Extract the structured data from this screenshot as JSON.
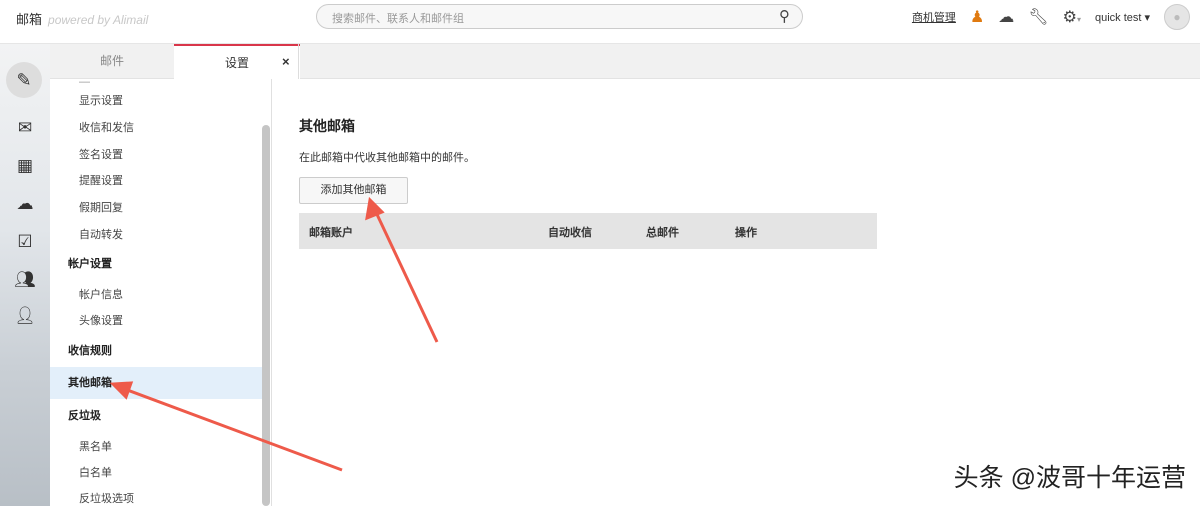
{
  "header": {
    "app": "邮箱",
    "powered": "powered by Alimail",
    "search_placeholder": "搜索邮件、联系人和邮件组",
    "link": "商机管理",
    "user": "quick test ▾"
  },
  "tabs": [
    {
      "label": "邮件"
    },
    {
      "label": "设置"
    }
  ],
  "sidebar": {
    "items": [
      "显示设置",
      "收信和发信",
      "签名设置",
      "提醒设置",
      "假期回复",
      "自动转发",
      "帐户设置",
      "帐户信息",
      "头像设置",
      "收信规则",
      "其他邮箱",
      "反垃圾",
      "黑名单",
      "白名单",
      "反垃圾选项"
    ]
  },
  "main": {
    "title": "其他邮箱",
    "description": "在此邮箱中代收其他邮箱中的邮件。",
    "add_button": "添加其他邮箱",
    "columns": [
      "邮箱账户",
      "自动收信",
      "总邮件",
      "操作"
    ]
  },
  "watermark": "头条 @波哥十年运营"
}
